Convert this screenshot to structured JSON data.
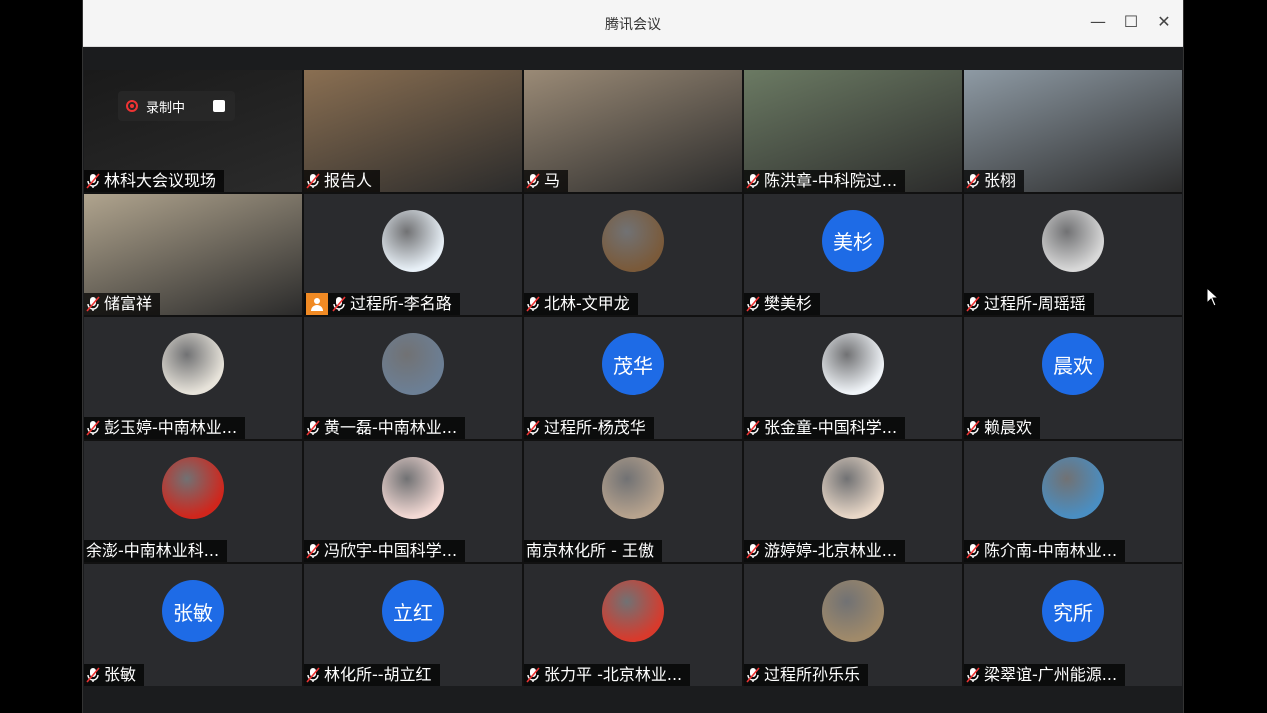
{
  "window": {
    "title": "腾讯会议",
    "controls": {
      "minimize": "—",
      "maximize": "☐",
      "close": "✕"
    }
  },
  "recording": {
    "label": "录制中"
  },
  "participants": [
    {
      "name": "林科大会议现场",
      "type": "video",
      "bg": "#1a1a1a"
    },
    {
      "name": "报告人",
      "type": "video",
      "bg": "#8a6f52"
    },
    {
      "name": "马",
      "type": "video",
      "bg": "#9a8a76"
    },
    {
      "name": "陈洪章-中科院过...",
      "type": "video",
      "bg": "#6b7a63"
    },
    {
      "name": "张栩",
      "type": "video",
      "bg": "#8e9aa4"
    },
    {
      "name": "储富祥",
      "type": "video",
      "bg": "#b0a48e"
    },
    {
      "name": "过程所-李名路",
      "type": "avatar",
      "avatar_color": "#e8f0f7",
      "icon": "cartoon-avatar-icon",
      "host": true
    },
    {
      "name": "北林-文甲龙",
      "type": "avatar",
      "avatar_color": "#7a5a3a",
      "icon": "photo-avatar-icon"
    },
    {
      "name": "樊美杉",
      "type": "text",
      "avatar_text": "美杉"
    },
    {
      "name": "过程所-周瑶瑶",
      "type": "avatar",
      "avatar_color": "#d8d8d8",
      "icon": "photo-avatar-icon"
    },
    {
      "name": "彭玉婷-中南林业...",
      "type": "avatar",
      "avatar_color": "#e7e3da",
      "icon": "plant-avatar-icon"
    },
    {
      "name": "黄一磊-中南林业...",
      "type": "avatar",
      "avatar_color": "#6c7f95",
      "icon": "lake-avatar-icon"
    },
    {
      "name": "过程所-杨茂华",
      "type": "text",
      "avatar_text": "茂华"
    },
    {
      "name": "张金童-中国科学...",
      "type": "avatar",
      "avatar_color": "#f0f4f8",
      "icon": "graduate-avatar-icon"
    },
    {
      "name": "赖晨欢",
      "type": "text",
      "avatar_text": "晨欢"
    },
    {
      "name": "余澎-中南林业科...",
      "type": "avatar",
      "avatar_color": "#d0261c",
      "icon": "festival-avatar-icon",
      "nomic": true
    },
    {
      "name": "冯欣宇-中国科学...",
      "type": "avatar",
      "avatar_color": "#f3d9d4",
      "icon": "cartoon-avatar-icon"
    },
    {
      "name": "南京林化所 - 王傲",
      "type": "avatar",
      "avatar_color": "#b7a38e",
      "icon": "photo-avatar-icon",
      "nomic": true
    },
    {
      "name": "游婷婷-北京林业...",
      "type": "avatar",
      "avatar_color": "#e8d7c7",
      "icon": "baby-avatar-icon"
    },
    {
      "name": "陈介南-中南林业...",
      "type": "avatar",
      "avatar_color": "#4a8ec2",
      "icon": "wave-avatar-icon"
    },
    {
      "name": "张敏",
      "type": "text",
      "avatar_text": "张敏"
    },
    {
      "name": "林化所--胡立红",
      "type": "text",
      "avatar_text": "立红"
    },
    {
      "name": "张力平 -北京林业...",
      "type": "avatar",
      "avatar_color": "#d83a2c",
      "icon": "flower-avatar-icon"
    },
    {
      "name": "过程所孙乐乐",
      "type": "avatar",
      "avatar_color": "#a08a6a",
      "icon": "temple-avatar-icon"
    },
    {
      "name": "梁翠谊-广州能源...",
      "type": "text",
      "avatar_text": "究所"
    }
  ]
}
